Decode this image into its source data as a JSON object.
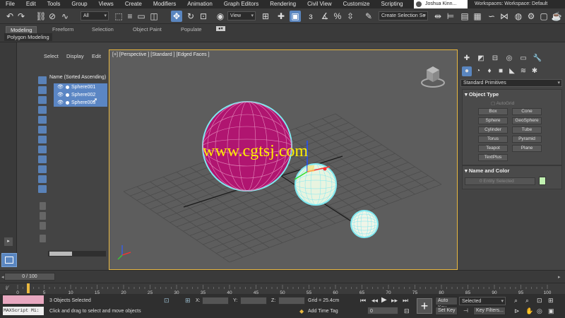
{
  "menu": [
    "File",
    "Edit",
    "Tools",
    "Group",
    "Views",
    "Create",
    "Modifiers",
    "Animation",
    "Graph Editors",
    "Rendering",
    "Civil View",
    "Customize",
    "Scripting"
  ],
  "user": "Joshua Kinn...",
  "workspace": "Workspaces: Workspace: Default",
  "toolbar": {
    "filter": "All",
    "ref_coord": "View",
    "selection_set": "Create Selection Se"
  },
  "ribbon": {
    "tabs": [
      "Modeling",
      "Freeform",
      "Selection",
      "Object Paint",
      "Populate"
    ],
    "subtitle": "Polygon Modeling"
  },
  "scene_explorer": {
    "menu": [
      "Select",
      "Display",
      "Edit"
    ],
    "column_header": "Name (Sorted Ascending)",
    "objects": [
      "Sphere001",
      "Sphere002",
      "Sphere003"
    ]
  },
  "viewport": {
    "label": "[+] [Perspective ] [Standard ] [Edged Faces ]",
    "watermark": "www.cgtsj.com"
  },
  "command_panel": {
    "category": "Standard Primitives",
    "object_type_title": "Object Type",
    "autogrid": "AutoGrid",
    "primitives": [
      "Box",
      "Cone",
      "Sphere",
      "GeoSphere",
      "Cylinder",
      "Tube",
      "Torus",
      "Pyramid",
      "Teapot",
      "Plane",
      "TextPlus"
    ],
    "name_color_title": "Name and Color",
    "name_value": "0 Entity Selected",
    "object_color": "#c0f0b0"
  },
  "timeline": {
    "frame_display": "0 / 100",
    "ticks": [
      0,
      5,
      10,
      15,
      20,
      25,
      30,
      35,
      40,
      45,
      50,
      55,
      60,
      65,
      70,
      75,
      80,
      85,
      90,
      95,
      100
    ]
  },
  "status": {
    "maxscript": "MAXScript Mi:",
    "selection": "3 Objects Selected",
    "prompt": "Click and drag to select and move objects",
    "x_label": "X:",
    "y_label": "Y:",
    "z_label": "Z:",
    "grid": "Grid = 25.4cm",
    "add_time_tag": "Add Time Tag",
    "auto_key": "Auto Key",
    "set_key": "Set Key",
    "selected": "Selected",
    "key_filters": "Key Filters...",
    "frame": "0"
  },
  "colors": {
    "sphere1": "#b01570",
    "sphere_small": "#f0f5e8",
    "selection_outline": "#7fe8f0",
    "accent": "#5a86c0"
  }
}
